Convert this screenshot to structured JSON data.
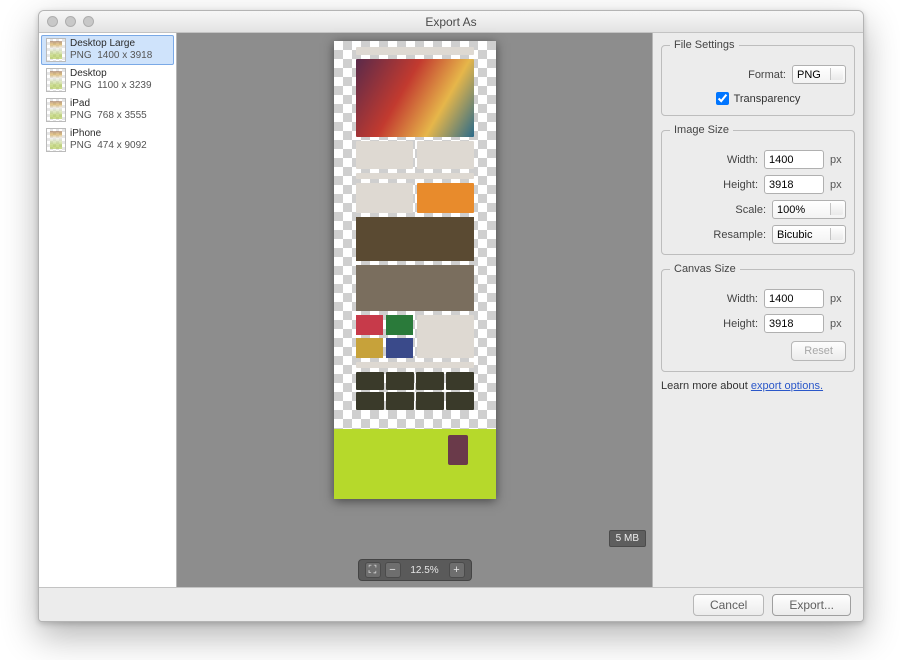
{
  "window": {
    "title": "Export As"
  },
  "assets": [
    {
      "name": "Desktop Large",
      "format": "PNG",
      "dims": "1400 x 3918",
      "selected": true
    },
    {
      "name": "Desktop",
      "format": "PNG",
      "dims": "1100 x 3239",
      "selected": false
    },
    {
      "name": "iPad",
      "format": "PNG",
      "dims": "768 x 3555",
      "selected": false
    },
    {
      "name": "iPhone",
      "format": "PNG",
      "dims": "474 x 9092",
      "selected": false
    }
  ],
  "preview": {
    "file_size_label": "5 MB",
    "zoom_label": "12.5%"
  },
  "file_settings": {
    "legend": "File Settings",
    "format_label": "Format:",
    "format_value": "PNG",
    "transparency_label": "Transparency",
    "transparency_checked": true
  },
  "image_size": {
    "legend": "Image Size",
    "width_label": "Width:",
    "width_value": "1400",
    "width_unit": "px",
    "height_label": "Height:",
    "height_value": "3918",
    "height_unit": "px",
    "scale_label": "Scale:",
    "scale_value": "100%",
    "resample_label": "Resample:",
    "resample_value": "Bicubic"
  },
  "canvas_size": {
    "legend": "Canvas Size",
    "width_label": "Width:",
    "width_value": "1400",
    "width_unit": "px",
    "height_label": "Height:",
    "height_value": "3918",
    "height_unit": "px",
    "reset_label": "Reset"
  },
  "help": {
    "prefix": "Learn more about ",
    "link": "export options."
  },
  "buttons": {
    "cancel": "Cancel",
    "export": "Export..."
  }
}
